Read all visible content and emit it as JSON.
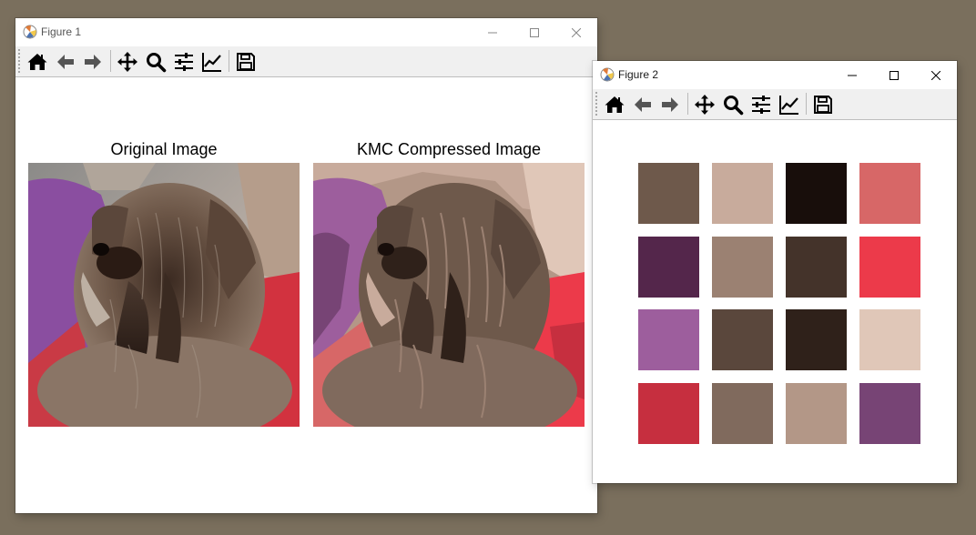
{
  "figure1": {
    "title": "Figure 1",
    "axes": [
      {
        "title": "Original Image",
        "variant": "original"
      },
      {
        "title": "KMC Compressed Image",
        "variant": "compressed"
      }
    ]
  },
  "figure2": {
    "title": "Figure 2",
    "palette": [
      "#6e594b",
      "#c8ab9c",
      "#180e0b",
      "#d76767",
      "#54264b",
      "#9b8172",
      "#44332a",
      "#ec3a4a",
      "#9d5e9d",
      "#5a473c",
      "#2f211a",
      "#e0c7b8",
      "#c62f3f",
      "#806a5d",
      "#b39787",
      "#774475"
    ]
  },
  "toolbar_tools": [
    "home-icon",
    "back-icon",
    "forward-icon",
    "pan-icon",
    "zoom-icon",
    "configure-subplots-icon",
    "edit-axis-icon",
    "save-icon"
  ],
  "colors": {
    "desktop": "#7a6f5d",
    "toolbar": "#f0f0f0"
  }
}
